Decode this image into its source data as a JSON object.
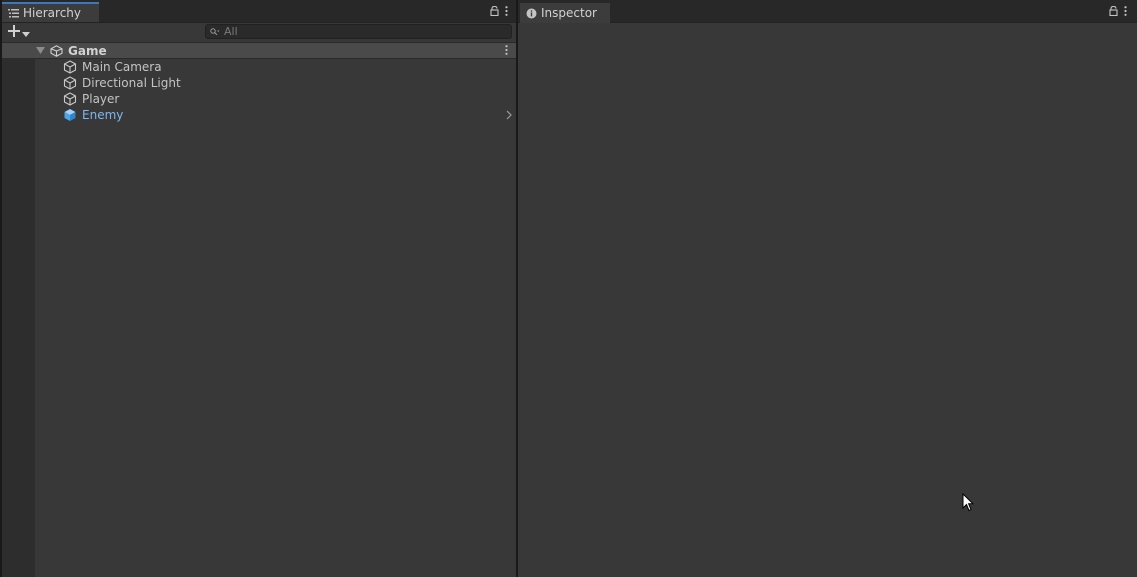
{
  "hierarchy": {
    "tab_title": "Hierarchy",
    "search_placeholder": "All",
    "scene": {
      "name": "Game"
    },
    "objects": [
      {
        "name": "Main Camera",
        "icon": "gameobject-cube-icon"
      },
      {
        "name": "Directional Light",
        "icon": "gameobject-cube-icon"
      },
      {
        "name": "Player",
        "icon": "gameobject-cube-icon"
      },
      {
        "name": "Enemy",
        "icon": "prefab-cube-icon"
      }
    ]
  },
  "inspector": {
    "tab_title": "Inspector"
  },
  "colors": {
    "accent": "#3a79bb",
    "prefab": "#7cb8ee",
    "panel": "#383838"
  }
}
